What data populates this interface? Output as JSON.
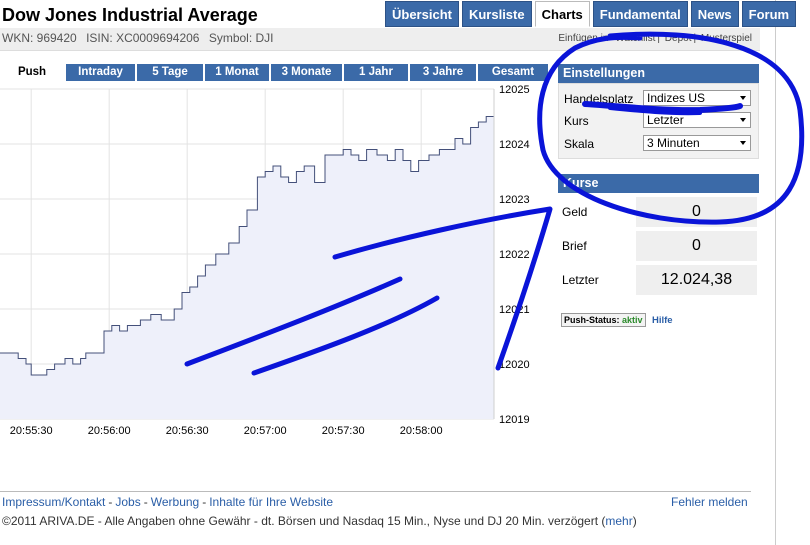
{
  "header": {
    "title": "Dow Jones Industrial Average",
    "wkn": "WKN: 969420",
    "isin": "ISIN: XC0009694206",
    "symbol": "Symbol: DJI"
  },
  "topnav": [
    {
      "label": "Übersicht",
      "active": false
    },
    {
      "label": "Kursliste",
      "active": false
    },
    {
      "label": "Charts",
      "active": true
    },
    {
      "label": "Fundamental",
      "active": false
    },
    {
      "label": "News",
      "active": false
    },
    {
      "label": "Forum",
      "active": false
    }
  ],
  "toollinks": {
    "einfuegen": "Einfügen in",
    "watchlist": "Watchlist",
    "depot": "Depot",
    "musterspiel": "Musterspiel"
  },
  "range_tabs": [
    {
      "label": "Push",
      "active": true
    },
    {
      "label": "Intraday",
      "active": false
    },
    {
      "label": "5 Tage",
      "active": false
    },
    {
      "label": "1 Monat",
      "active": false
    },
    {
      "label": "3 Monate",
      "active": false
    },
    {
      "label": "1 Jahr",
      "active": false
    },
    {
      "label": "3 Jahre",
      "active": false
    },
    {
      "label": "Gesamt",
      "active": false
    }
  ],
  "settings": {
    "title": "Einstellungen",
    "handelsplatz_label": "Handelsplatz",
    "handelsplatz_value": "Indizes US",
    "kurs_label": "Kurs",
    "kurs_value": "Letzter",
    "skala_label": "Skala",
    "skala_value": "3 Minuten"
  },
  "kurse": {
    "title": "Kurse",
    "geld_label": "Geld",
    "geld_value": "0",
    "brief_label": "Brief",
    "brief_value": "0",
    "letzter_label": "Letzter",
    "letzter_value": "12.024,38"
  },
  "push_status": {
    "label": "Push-Status:",
    "value": "aktiv",
    "hilfe": "Hilfe"
  },
  "footer": {
    "impressum": "Impressum/Kontakt",
    "jobs": "Jobs",
    "werbung": "Werbung",
    "inhalte": "Inhalte für Ihre Website",
    "fehler": "Fehler melden",
    "copyright": "©2011 ARIVA.DE - Alle Angaben ohne Gewähr - dt. Börsen und Nasdaq 15 Min., Nyse und DJ 20 Min. verzögert (",
    "mehr": "mehr",
    "close_paren": ")"
  },
  "colors": {
    "nav_blue": "#3b6aa8",
    "line": "#44507a",
    "fill": "#eef0fa",
    "scribble": "#0a14d8"
  },
  "chart_data": {
    "type": "area",
    "x_ticks": [
      "20:55:30",
      "20:56:00",
      "20:56:30",
      "20:57:00",
      "20:57:30",
      "20:58:00"
    ],
    "y_ticks": [
      12019,
      12020,
      12021,
      12022,
      12023,
      12024,
      12025
    ],
    "ylim": [
      12019,
      12025
    ],
    "xlim_seconds": [
      0,
      190
    ],
    "x_tick_seconds": [
      12,
      42,
      72,
      102,
      132,
      162
    ],
    "grid": true,
    "series": [
      {
        "x": [
          0,
          7,
          10,
          12,
          18,
          21,
          25,
          28,
          31,
          33,
          40,
          43,
          46,
          49,
          52,
          54,
          58,
          62,
          67,
          70,
          73,
          76,
          79,
          83,
          88,
          92,
          95,
          99,
          102,
          105,
          108,
          111,
          114,
          117,
          121,
          125,
          128,
          132,
          135,
          138,
          141,
          145,
          149,
          152,
          155,
          158,
          161,
          165,
          169,
          172,
          175,
          178,
          181,
          184,
          187,
          190
        ],
        "y": [
          12020.2,
          12020.1,
          12020.0,
          12019.8,
          12019.9,
          12020.0,
          12020.1,
          12020.0,
          12020.1,
          12020.2,
          12020.6,
          12020.7,
          12020.6,
          12020.7,
          12020.7,
          12020.8,
          12020.9,
          12020.8,
          12021.0,
          12021.3,
          12021.4,
          12021.6,
          12021.8,
          12022.0,
          12022.2,
          12022.5,
          12022.8,
          12023.4,
          12023.5,
          12023.6,
          12023.4,
          12023.3,
          12023.5,
          12023.6,
          12023.3,
          12023.8,
          12023.8,
          12023.9,
          12023.8,
          12023.7,
          12023.9,
          12023.8,
          12023.7,
          12023.9,
          12023.7,
          12023.5,
          12023.7,
          12023.8,
          12023.9,
          12023.9,
          12024.1,
          12024.0,
          12024.3,
          12024.4,
          12024.5,
          12024.4
        ]
      }
    ]
  }
}
